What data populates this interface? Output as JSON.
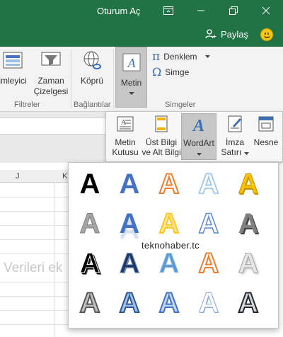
{
  "titlebar": {
    "title": "Oturum Aç",
    "share_label": "Paylaş"
  },
  "ribbon": {
    "groups": {
      "filtreler": "Filtreler",
      "baglantilar": "Bağlantılar",
      "simgeler": "Simgeler"
    },
    "buttons": {
      "dilimleyici": "imleyici",
      "zaman_1": "Zaman",
      "zaman_2": "Çizelgesi",
      "kopru": "Köprü",
      "metin": "Metin",
      "denklem": "Denklem",
      "simge": "Simge",
      "pi_glyph": "π",
      "omega_glyph": "Ω"
    }
  },
  "metin_panel": {
    "metin_kutusu_1": "Metin",
    "metin_kutusu_2": "Kutusu",
    "ust_bilgi_1": "Üst Bilgi",
    "ust_bilgi_2": "ve Alt Bilgi",
    "wordart": "WordArt",
    "imza_1": "İmza",
    "imza_2": "Satırı",
    "nesne": "Nesne"
  },
  "sheet": {
    "columns": [
      "J",
      "K"
    ],
    "ghost_text": "Verileri ek"
  },
  "gallery": {
    "glyph": "A"
  },
  "watermark": "teknohaber.tc",
  "colors": {
    "excel_green": "#217346",
    "wordart_blue": "#4472c4",
    "wordart_orange": "#ed7d31",
    "wordart_gold": "#ffc000",
    "wordart_gray": "#7f7f7f"
  }
}
